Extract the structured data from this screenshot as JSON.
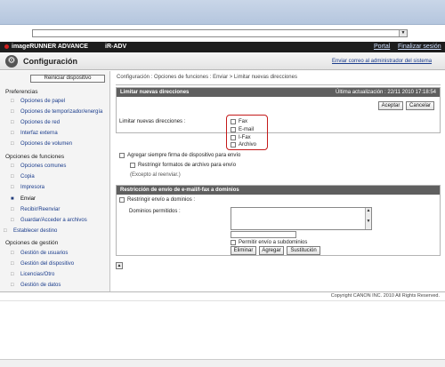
{
  "header": {
    "brand": "imageRUNNER ADVANCE",
    "model": "iR-ADV",
    "portal": "Portal",
    "logout": "Finalizar sesión",
    "title": "Configuración",
    "mail_admin": "Enviar correo al administrador del sistema"
  },
  "sidebar": {
    "reset_button": "Reiniciar dispositivo",
    "sections": [
      {
        "label": "Preferencias"
      },
      {
        "label": "Opciones de funciones"
      },
      {
        "label": "Opciones de gestión"
      }
    ],
    "preferences_items": [
      {
        "label": "Opciones de papel"
      },
      {
        "label": "Opciones de temporizador/energía"
      },
      {
        "label": "Opciones de red"
      },
      {
        "label": "Interfaz externa"
      },
      {
        "label": "Opciones de volumen"
      }
    ],
    "function_items": [
      {
        "label": "Opciones comunes"
      },
      {
        "label": "Copia"
      },
      {
        "label": "Impresora"
      },
      {
        "label": "Enviar"
      },
      {
        "label": "Recibir/Reenviar"
      },
      {
        "label": "Guardar/Acceder a archivos"
      },
      {
        "label": "Establecer destino"
      }
    ],
    "management_items": [
      {
        "label": "Gestión de usuarios"
      },
      {
        "label": "Gestión del dispositivo"
      },
      {
        "label": "Licencias/Otro"
      },
      {
        "label": "Gestión de datos"
      }
    ],
    "selected": "Enviar"
  },
  "main": {
    "breadcrumb": "Configuración : Opciones de funciones : Enviar > Limitar nuevas direcciones",
    "panel1_title": "Limitar nuevas direcciones",
    "last_update": "Última actualización : 22/11 2010 17:18:54",
    "accept_button": "Aceptar",
    "cancel_button": "Cancelar",
    "limit_label": "Limitar nuevas direcciones :",
    "limit_options": [
      "Fax",
      "E-mail",
      "I-Fax",
      "Archivo"
    ],
    "add_signature": "Agregar siempre firma de dispositivo para envío",
    "restrict_formats": "Restringir formatos de archivo para envío",
    "except_forward": "(Excepto al reenviar.)",
    "panel2_title": "Restricción de envío de e-mail/I-fax a dominios",
    "restrict_domains": "Restringir envío a dominios :",
    "allowed_domains": "Dominios permitidos :",
    "allow_subdomains": "Permitir envío a subdominios",
    "delete_button": "Eliminar",
    "add_button": "Agregar",
    "replace_button": "Sustitución"
  },
  "footer": {
    "copyright": "Copyright CANON INC. 2010 All Rights Reserved."
  },
  "colors": {
    "accent": "#c41a1a",
    "panel_header": "#5f5f5f",
    "link": "#1a3c8c"
  }
}
